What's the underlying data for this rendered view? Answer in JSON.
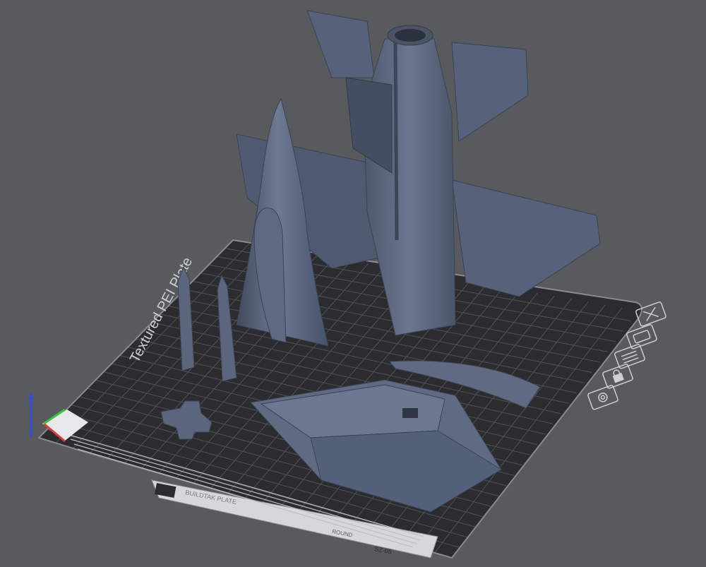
{
  "viewport": {
    "name": "3D build plate viewport",
    "background": "#595a5e",
    "bed_color": "#2e2e31",
    "grid_color": "#6b6b70",
    "model_color": "#5d6a80"
  },
  "bed": {
    "texture_label": "Textured PEI Plate",
    "stamp_label": "BUILDTAK PLATE",
    "corner_text": "ROUND",
    "corner_code": "SZ-05"
  },
  "side_toolbar": {
    "buttons": [
      {
        "icon": "close-x-icon",
        "label": "X"
      },
      {
        "icon": "orient-icon",
        "label": ""
      },
      {
        "icon": "arrange-icon",
        "label": ""
      },
      {
        "icon": "lock-icon",
        "label": ""
      },
      {
        "icon": "settings-gear-icon",
        "label": ""
      }
    ]
  },
  "axes": {
    "x_color": "#d93a3a",
    "y_color": "#3bc43b",
    "z_color": "#2f4fd9"
  },
  "models": [
    "jet-fuselage",
    "nose-cone",
    "missile-left",
    "missile-right",
    "cross-part",
    "canopy-base",
    "curved-strip"
  ]
}
